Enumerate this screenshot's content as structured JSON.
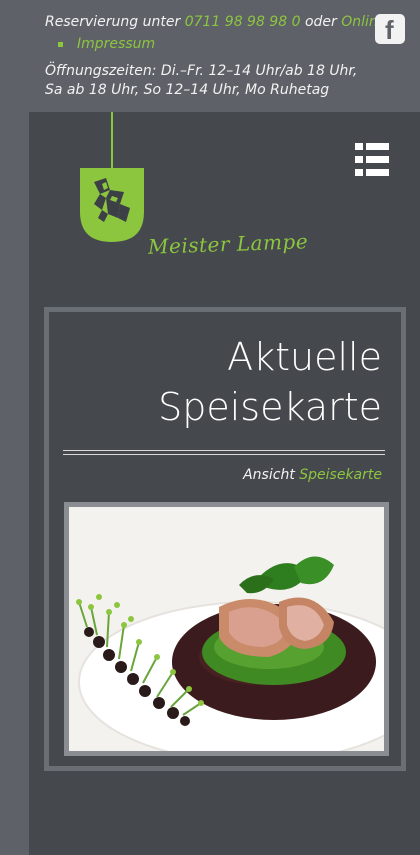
{
  "header": {
    "reservation_prefix": "Reservierung unter",
    "phone": "0711 98 98 98 0",
    "or_text": "oder",
    "online_link": "Online",
    "impressum_link": "Impressum",
    "opening_hours": "Öffnungszeiten: Di.–Fr. 12–14 Uhr/ab 18 Uhr, Sa ab 18 Uhr, So 12–14 Uhr, Mo Ruhetag",
    "facebook_icon": "facebook-icon"
  },
  "brand": {
    "name": "Meister Lampe",
    "logo_icon": "hare-shield-logo"
  },
  "menu": {
    "icon": "hamburger-menu-icon"
  },
  "card": {
    "title_line1": "Aktuelle",
    "title_line2": "Speisekarte",
    "view_prefix": "Ansicht",
    "view_link": "Speisekarte",
    "photo_icon": "food-photo"
  },
  "colors": {
    "accent_green": "#8cc63f",
    "panel_dark": "#45484d",
    "page_bg": "#5e6167",
    "text_light": "#f2f2f2"
  }
}
